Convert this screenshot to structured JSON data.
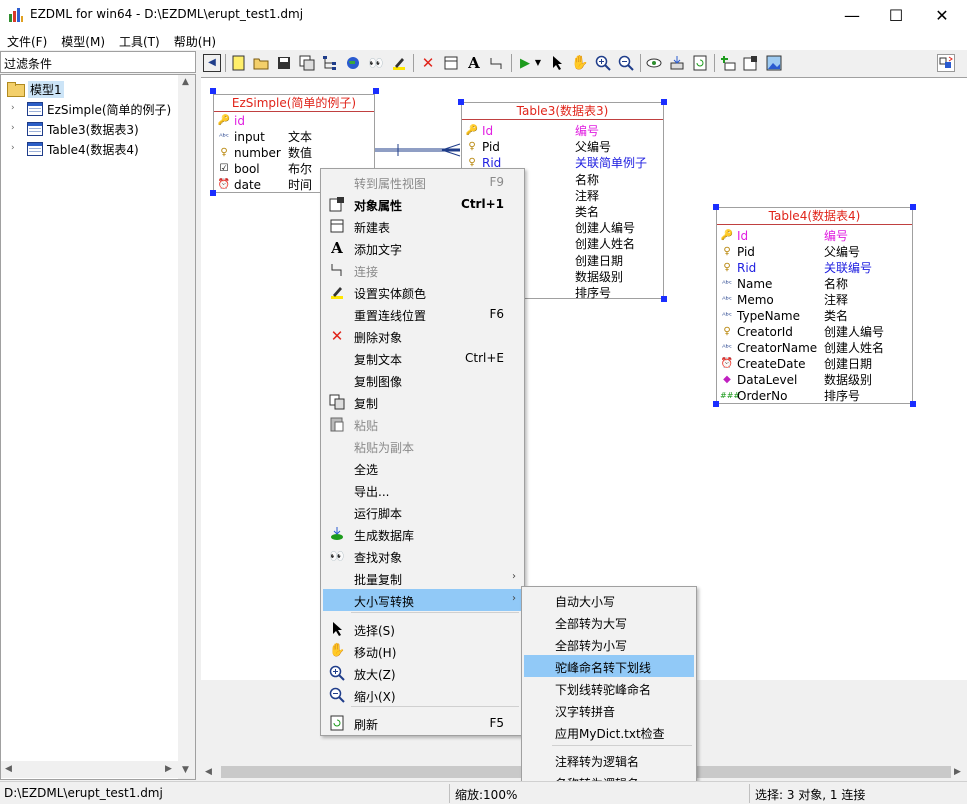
{
  "window": {
    "title": "EZDML for win64 - D:\\EZDML\\erupt_test1.dmj",
    "minimize": "—",
    "maximize": "☐",
    "close": "✕"
  },
  "menubar": [
    "文件(F)",
    "模型(M)",
    "工具(T)",
    "帮助(H)"
  ],
  "left_panel": {
    "filter_label": "过滤条件",
    "tree": {
      "root": "模型1",
      "items": [
        "EzSimple(简单的例子)",
        "Table3(数据表3)",
        "Table4(数据表4)"
      ]
    }
  },
  "entities": {
    "ezsimple": {
      "title": "EzSimple(简单的例子)",
      "fields": [
        {
          "name": "id",
          "comment": "",
          "icon": "key-icon",
          "color": "#e020e0"
        },
        {
          "name": "input",
          "comment": "文本",
          "icon": "text-type-icon",
          "color": "#000000"
        },
        {
          "name": "number",
          "comment": "数值",
          "icon": "number-icon",
          "color": "#000000"
        },
        {
          "name": "bool",
          "comment": "布尔",
          "icon": "checkbox-icon",
          "color": "#000000"
        },
        {
          "name": "date",
          "comment": "时间",
          "icon": "clock-icon",
          "color": "#000000"
        }
      ]
    },
    "table3": {
      "title": "Table3(数据表3)",
      "fields": [
        {
          "name": "Id",
          "comment": "编号",
          "icon": "key-icon",
          "color": "#e020e0"
        },
        {
          "name": "Pid",
          "comment": "父编号",
          "icon": "number-icon",
          "color": "#000000"
        },
        {
          "name": "Rid",
          "comment": "关联简单例子",
          "icon": "number-icon",
          "color": "#2020e0"
        },
        {
          "name": "",
          "comment": "名称",
          "icon": "",
          "color": "#000000"
        },
        {
          "name": "",
          "comment": "注释",
          "icon": "",
          "color": "#000000"
        },
        {
          "name": "me",
          "comment": "类名",
          "icon": "",
          "color": "#000000"
        },
        {
          "name": "d",
          "comment": "创建人编号",
          "icon": "",
          "color": "#000000"
        },
        {
          "name": "Name",
          "comment": "创建人姓名",
          "icon": "",
          "color": "#000000"
        },
        {
          "name": "ate",
          "comment": "创建日期",
          "icon": "",
          "color": "#000000"
        },
        {
          "name": "el",
          "comment": "数据级别",
          "icon": "",
          "color": "#000000"
        },
        {
          "name": "o",
          "comment": "排序号",
          "icon": "",
          "color": "#000000"
        }
      ]
    },
    "table4": {
      "title": "Table4(数据表4)",
      "fields": [
        {
          "name": "Id",
          "comment": "编号",
          "icon": "key-icon",
          "color": "#e020e0"
        },
        {
          "name": "Pid",
          "comment": "父编号",
          "icon": "number-icon",
          "color": "#000000"
        },
        {
          "name": "Rid",
          "comment": "关联编号",
          "icon": "number-icon",
          "color": "#2020e0"
        },
        {
          "name": "Name",
          "comment": "名称",
          "icon": "text-type-icon",
          "color": "#000000"
        },
        {
          "name": "Memo",
          "comment": "注释",
          "icon": "text-type-icon",
          "color": "#000000"
        },
        {
          "name": "TypeName",
          "comment": "类名",
          "icon": "text-type-icon",
          "color": "#000000"
        },
        {
          "name": "CreatorId",
          "comment": "创建人编号",
          "icon": "number-icon",
          "color": "#000000"
        },
        {
          "name": "CreatorName",
          "comment": "创建人姓名",
          "icon": "text-type-icon",
          "color": "#000000"
        },
        {
          "name": "CreateDate",
          "comment": "创建日期",
          "icon": "clock-icon",
          "color": "#000000"
        },
        {
          "name": "DataLevel",
          "comment": "数据级别",
          "icon": "enum-icon",
          "color": "#000000"
        },
        {
          "name": "OrderNo",
          "comment": "排序号",
          "icon": "hash-icon",
          "color": "#000000"
        }
      ]
    }
  },
  "context_menu": {
    "items": [
      {
        "label": "转到属性视图",
        "shortcut": "F9",
        "icon": "",
        "disabled": true
      },
      {
        "label": "对象属性",
        "shortcut": "Ctrl+1",
        "icon": "properties-icon",
        "bold": true
      },
      {
        "label": "新建表",
        "shortcut": "",
        "icon": "new-table-icon"
      },
      {
        "label": "添加文字",
        "shortcut": "",
        "icon": "add-text-icon"
      },
      {
        "label": "连接",
        "shortcut": "",
        "icon": "connect-icon",
        "disabled": true
      },
      {
        "label": "设置实体颜色",
        "shortcut": "",
        "icon": "color-pen-icon"
      },
      {
        "label": "重置连线位置",
        "shortcut": "F6",
        "icon": ""
      },
      {
        "label": "删除对象",
        "shortcut": "",
        "icon": "delete-icon"
      },
      {
        "label": "复制文本",
        "shortcut": "Ctrl+E",
        "icon": ""
      },
      {
        "label": "复制图像",
        "shortcut": "",
        "icon": ""
      },
      {
        "label": "复制",
        "shortcut": "",
        "icon": "copy-icon"
      },
      {
        "label": "粘贴",
        "shortcut": "",
        "icon": "paste-icon",
        "disabled": true
      },
      {
        "label": "粘贴为副本",
        "shortcut": "",
        "icon": "",
        "disabled": true
      },
      {
        "label": "全选",
        "shortcut": "",
        "icon": ""
      },
      {
        "label": "导出...",
        "shortcut": "",
        "icon": ""
      },
      {
        "label": "运行脚本",
        "shortcut": "",
        "icon": ""
      },
      {
        "label": "生成数据库",
        "shortcut": "",
        "icon": "generate-db-icon"
      },
      {
        "label": "查找对象",
        "shortcut": "",
        "icon": "find-icon"
      },
      {
        "label": "批量复制",
        "shortcut": "",
        "icon": "",
        "submenu": true
      },
      {
        "label": "大小写转换",
        "shortcut": "",
        "icon": "",
        "submenu": true,
        "highlighted": true
      },
      {
        "label": "选择(S)",
        "shortcut": "",
        "icon": "select-arrow-icon"
      },
      {
        "label": "移动(H)",
        "shortcut": "",
        "icon": "hand-icon"
      },
      {
        "label": "放大(Z)",
        "shortcut": "",
        "icon": "zoom-in-icon"
      },
      {
        "label": "缩小(X)",
        "shortcut": "",
        "icon": "zoom-out-icon"
      },
      {
        "label": "刷新",
        "shortcut": "F5",
        "icon": "refresh-icon"
      }
    ]
  },
  "submenu": {
    "items": [
      {
        "label": "自动大小写"
      },
      {
        "label": "全部转为大写"
      },
      {
        "label": "全部转为小写"
      },
      {
        "label": "驼峰命名转下划线",
        "highlighted": true
      },
      {
        "label": "下划线转驼峰命名"
      },
      {
        "label": "汉字转拼音"
      },
      {
        "label": "应用MyDict.txt检查"
      },
      {
        "label": "注释转为逻辑名"
      },
      {
        "label": "名称转为逻辑名"
      }
    ]
  },
  "statusbar": {
    "path": "D:\\EZDML\\erupt_test1.dmj",
    "zoom": "缩放:100%",
    "selection": "选择: 3 对象, 1 连接"
  },
  "colors": {
    "entity_title": "#e0241a",
    "key_field": "#e020e0",
    "fk_field": "#2020e0",
    "selection_handle": "#1a2eff",
    "menu_highlight": "#91c9f7"
  }
}
